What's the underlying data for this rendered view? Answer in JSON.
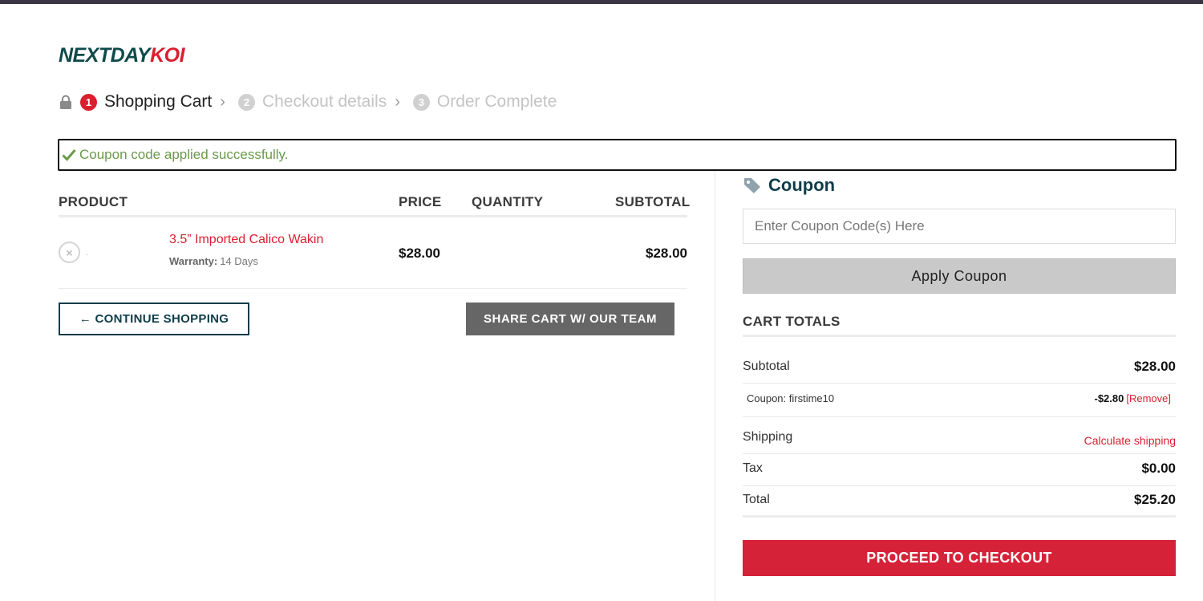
{
  "brand": {
    "logo_part1": "NEXTDAY",
    "logo_part2": "KOI"
  },
  "steps": [
    {
      "num": "1",
      "label": "Shopping Cart",
      "active": true
    },
    {
      "num": "2",
      "label": "Checkout details",
      "active": false
    },
    {
      "num": "3",
      "label": "Order Complete",
      "active": false
    }
  ],
  "notice": {
    "text": "Coupon code applied successfully."
  },
  "cart": {
    "headers": {
      "product": "PRODUCT",
      "price": "PRICE",
      "quantity": "QUANTITY",
      "subtotal": "SUBTOTAL"
    },
    "items": [
      {
        "name": "3.5” Imported Calico Wakin",
        "warranty_label": "Warranty:",
        "warranty_value": "14 Days",
        "price": "$28.00",
        "subtotal": "$28.00",
        "remove_symbol": "×"
      }
    ],
    "continue_label": "← CONTINUE SHOPPING",
    "share_label": "SHARE CART W/ OUR TEAM"
  },
  "coupon": {
    "title": "Coupon",
    "placeholder": "Enter Coupon Code(s) Here",
    "apply_label": "Apply Coupon"
  },
  "totals": {
    "title": "CART TOTALS",
    "subtotal_label": "Subtotal",
    "subtotal_value": "$28.00",
    "coupon_label": "Coupon: firstime10",
    "coupon_value": "-$2.80",
    "coupon_remove": "[Remove]",
    "shipping_label": "Shipping",
    "shipping_link": "Calculate shipping",
    "tax_label": "Tax",
    "tax_value": "$0.00",
    "total_label": "Total",
    "total_value": "$25.20",
    "checkout_label": "PROCEED TO CHECKOUT"
  },
  "colors": {
    "accent": "#d8202f",
    "brand_dark": "#0f4a4a",
    "success": "#6a9a4a"
  }
}
